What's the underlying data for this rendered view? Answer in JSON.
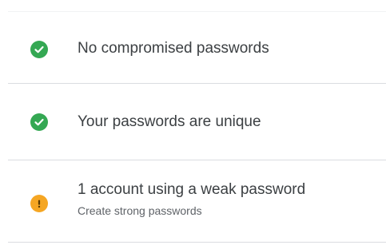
{
  "colors": {
    "ok_green": "#34a853",
    "warning_amber": "#f5a623",
    "divider": "#dadce0",
    "title_text": "#3c4043",
    "subtitle_text": "#5f6368"
  },
  "checks": [
    {
      "status_icon": "check-circle-icon",
      "title": "No compromised passwords"
    },
    {
      "status_icon": "check-circle-icon",
      "title": "Your passwords are unique"
    },
    {
      "status_icon": "warning-circle-icon",
      "title": "1 account using a weak password",
      "subtitle": "Create strong passwords"
    }
  ]
}
